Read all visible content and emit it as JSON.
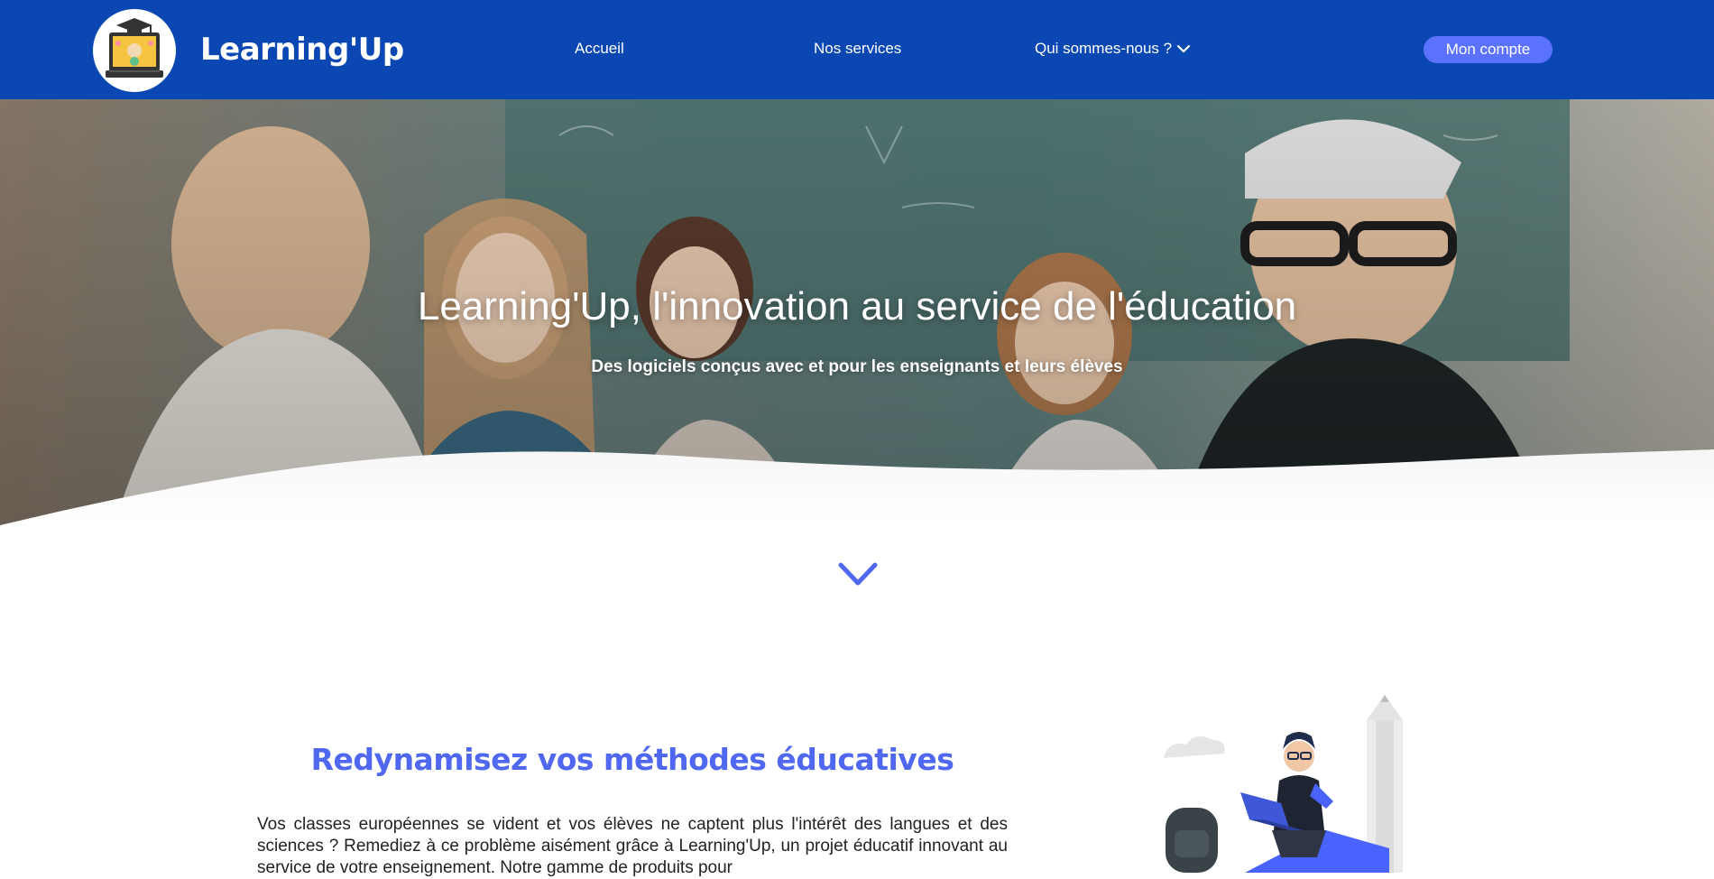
{
  "header": {
    "brand": "Learning'Up",
    "nav": {
      "accueil": "Accueil",
      "services": "Nos services",
      "qui": "Qui sommes-nous ?"
    },
    "account_button": "Mon compte"
  },
  "hero": {
    "title": "Learning'Up, l'innovation au service de l'éducation",
    "subtitle": "Des logiciels conçus avec et pour les enseignants et leurs élèves"
  },
  "section": {
    "title": "Redynamisez vos méthodes éducatives",
    "body": "Vos classes européennes se vident et vos élèves ne captent plus l'intérêt des langues et des sciences ? Remediez à ce problème aisément grâce à Learning'Up, un projet éducatif innovant au service de votre enseignement. Notre gamme de produits pour"
  },
  "icons": {
    "logo": "laptop-graduation-logo-icon",
    "dropdown": "chevron-down-icon",
    "scroll": "chevron-down-icon"
  },
  "colors": {
    "header_bg": "#0a47b3",
    "accent": "#5b72ff",
    "title_color": "#5067ef"
  }
}
